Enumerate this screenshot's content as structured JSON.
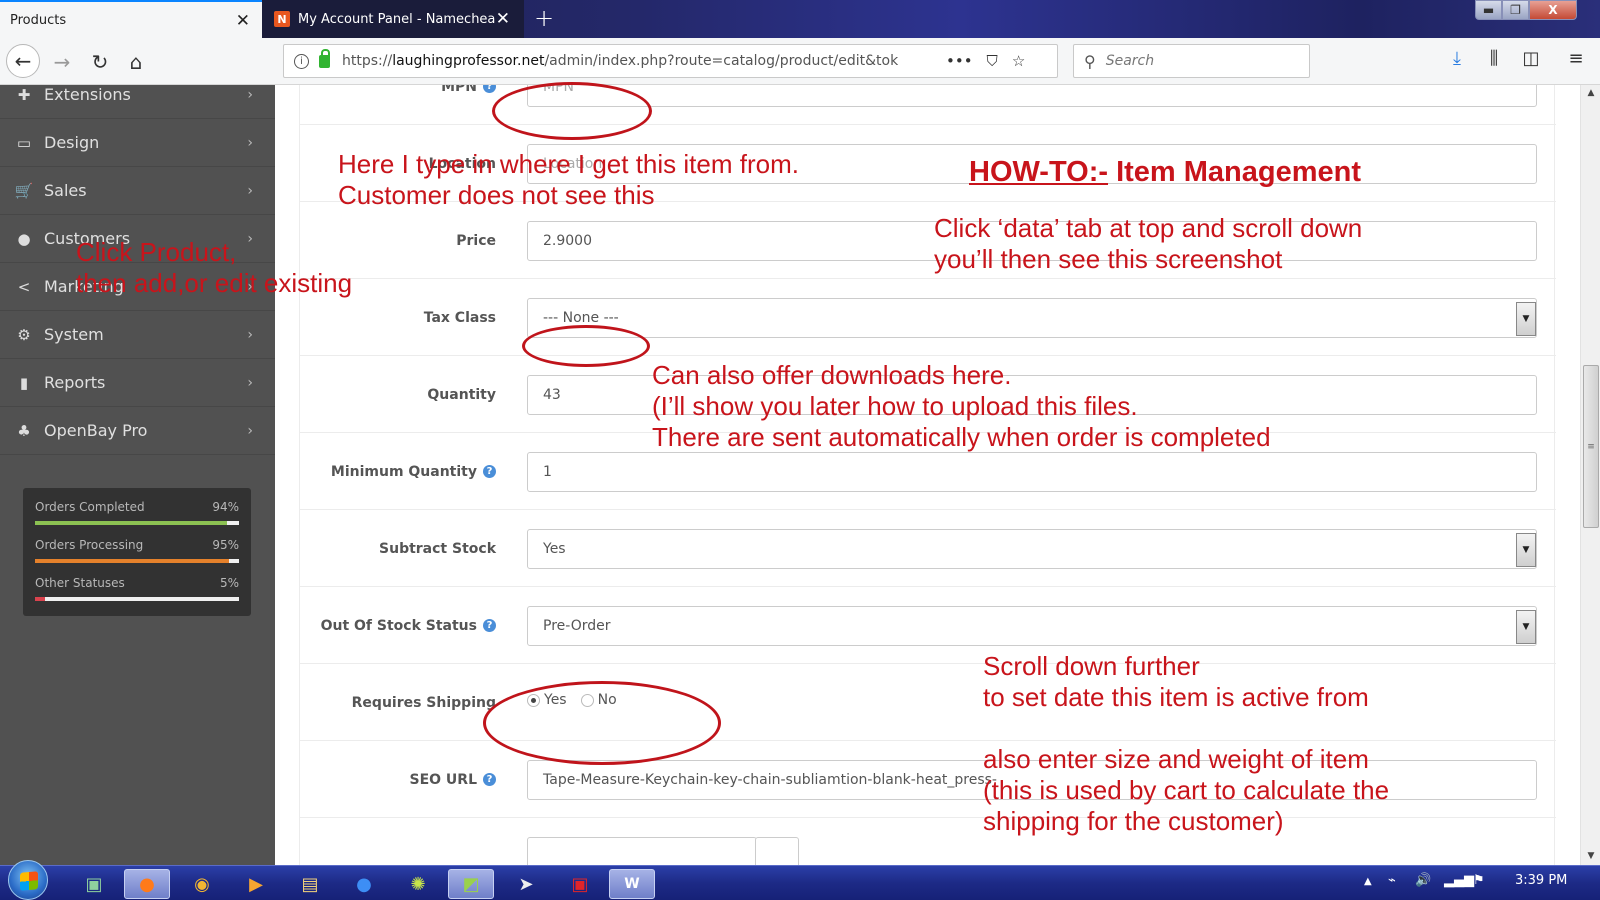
{
  "browser": {
    "tabs": [
      {
        "label": "Products",
        "active": true
      },
      {
        "label": "My Account Panel - Namechea",
        "active": false,
        "favicon": "N"
      }
    ],
    "new_tab": "+",
    "close_glyph": "✕",
    "window_controls": {
      "minimize": "▬",
      "maximize": "❐",
      "close": "X"
    },
    "url_prefix": "https://",
    "url_host": "laughingprofessor.net",
    "url_path": "/admin/index.php?route=catalog/product/edit&tok",
    "url_actions": "•••",
    "search_placeholder": "Search",
    "icons": [
      "back-icon",
      "forward-icon",
      "reload-icon",
      "home-icon",
      "info-icon",
      "lock-icon",
      "page-actions-icon",
      "pocket-icon",
      "bookmark-star-icon",
      "search-icon",
      "download-icon",
      "library-icon",
      "sidebar-icon",
      "menu-icon"
    ]
  },
  "sidebar": {
    "items": [
      {
        "label": "Extensions",
        "icon": "puzzle-icon",
        "glyph": "✚"
      },
      {
        "label": "Design",
        "icon": "monitor-icon",
        "glyph": "▭"
      },
      {
        "label": "Sales",
        "icon": "cart-icon",
        "glyph": "🛒"
      },
      {
        "label": "Customers",
        "icon": "user-icon",
        "glyph": "●"
      },
      {
        "label": "Marketing",
        "icon": "share-icon",
        "glyph": "<"
      },
      {
        "label": "System",
        "icon": "gear-icon",
        "glyph": "⚙"
      },
      {
        "label": "Reports",
        "icon": "bar-chart-icon",
        "glyph": "▮"
      },
      {
        "label": "OpenBay Pro",
        "icon": "openbay-icon",
        "glyph": "♣"
      }
    ],
    "chevron": "›",
    "stats": [
      {
        "label": "Orders Completed",
        "percent": 94,
        "display": "94%",
        "color": "#8cc152"
      },
      {
        "label": "Orders Processing",
        "percent": 95,
        "display": "95%",
        "color": "#e5812b"
      },
      {
        "label": "Other Statuses",
        "percent": 5,
        "display": "5%",
        "color": "#d9434e"
      }
    ]
  },
  "form": {
    "rows": [
      {
        "label": "MPN",
        "help": true,
        "type": "input",
        "value": "",
        "placeholder": "MPN"
      },
      {
        "label": "Location",
        "help": false,
        "type": "input",
        "value": "",
        "placeholder": "Location"
      },
      {
        "label": "Price",
        "help": false,
        "type": "input",
        "value": "2.9000"
      },
      {
        "label": "Tax Class",
        "help": false,
        "type": "select",
        "value": "--- None ---"
      },
      {
        "label": "Quantity",
        "help": false,
        "type": "input",
        "value": "43"
      },
      {
        "label": "Minimum Quantity",
        "help": true,
        "type": "input",
        "value": "1"
      },
      {
        "label": "Subtract Stock",
        "help": false,
        "type": "select",
        "value": "Yes"
      },
      {
        "label": "Out Of Stock Status",
        "help": true,
        "type": "select",
        "value": "Pre-Order"
      },
      {
        "label": "Requires Shipping",
        "help": false,
        "type": "radio",
        "options": [
          "Yes",
          "No"
        ],
        "selected": "Yes"
      },
      {
        "label": "SEO URL",
        "help": true,
        "type": "input",
        "value": "Tape-Measure-Keychain-key-chain-subliamtion-blank-heat_press-"
      }
    ],
    "help_glyph": "?",
    "dropdown_glyph": "▼"
  },
  "annotations": {
    "title_underlined": "HOW-TO:-",
    "title_rest": " Item Management",
    "location_note": [
      "Here I type in where I get this item from.",
      "Customer does not see this"
    ],
    "data_tab_note": [
      "Click ‘data’ tab at top and scroll down",
      "you’ll then see this screenshot"
    ],
    "product_note": [
      "Click Product,",
      "then add,or edit existing"
    ],
    "downloads_note": [
      "Can also offer downloads here.",
      "(I’ll show you later how to upload this files.",
      "There are sent automatically when order is completed"
    ],
    "scroll_note": [
      "Scroll down further",
      "to set date this item is active from",
      "",
      "also enter size and weight of item",
      "(this is used by cart to calculate the",
      "shipping for the customer)"
    ]
  },
  "taskbar": {
    "apps": [
      "remote-desktop-icon",
      "firefox-icon",
      "chrome-icon",
      "media-player-icon",
      "file-explorer-icon",
      "firefox-dev-icon",
      "app-icon",
      "coreldraw-icon",
      "paper-plane-icon",
      "camera-app-icon",
      "word-icon"
    ],
    "tray_up": "▲",
    "clock": "3:39 PM"
  }
}
